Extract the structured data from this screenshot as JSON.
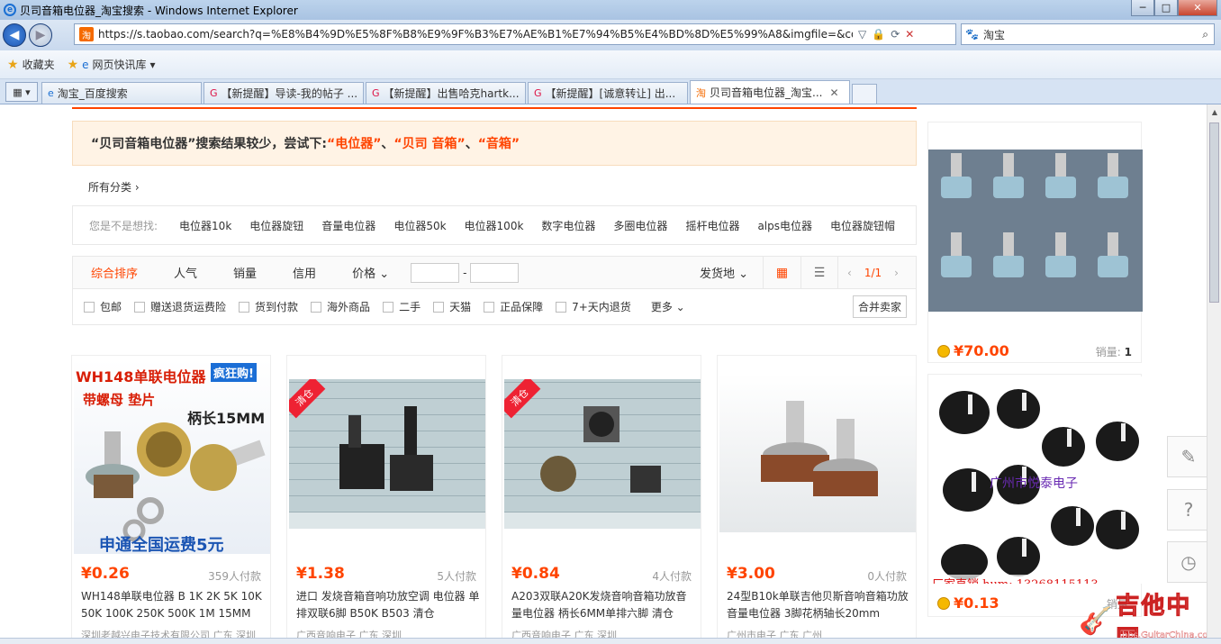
{
  "window": {
    "title": "贝司音箱电位器_淘宝搜索 - Windows Internet Explorer",
    "min": "─",
    "max": "□",
    "close": "✕"
  },
  "address": {
    "url": "https://s.taobao.com/search?q=%E8%B4%9D%E5%8F%B8%E9%9F%B3%E7%AE%B1%E7%94%B5%E4%BD%8D%E5%99%A8&imgfile=&commen"
  },
  "search": {
    "text": "淘宝"
  },
  "favbar": {
    "favorites": "收藏夹",
    "quicklib": "网页快讯库"
  },
  "tabs": [
    {
      "label": "淘宝_百度搜索",
      "icon": "e"
    },
    {
      "label": "【新提醒】导读-我的帖子 ...",
      "icon": "G"
    },
    {
      "label": "【新提醒】出售哈克hartk...",
      "icon": "G"
    },
    {
      "label": "【新提醒】[诚意转让] 出...",
      "icon": "G"
    },
    {
      "label": "贝司音箱电位器_淘宝...",
      "icon": "淘"
    }
  ],
  "notice": {
    "prefix": "“贝司音箱电位器”搜索结果较少，尝试下:",
    "s1": "“电位器”",
    "sep1": "、",
    "s2": "“贝司 音箱”",
    "sep2": "、",
    "s3": "“音箱”"
  },
  "crumb": "所有分类 ›",
  "related": {
    "label": "您是不是想找:",
    "items": [
      "电位器10k",
      "电位器旋钮",
      "音量电位器",
      "电位器50k",
      "电位器100k",
      "数字电位器",
      "多圈电位器",
      "摇杆电位器",
      "alps电位器",
      "电位器旋钮帽"
    ]
  },
  "sort": {
    "items": [
      "综合排序",
      "人气",
      "销量",
      "信用",
      "价格 ⌄"
    ],
    "dash": "-",
    "ship": "发货地 ⌄",
    "prev": "‹",
    "page": "1/1",
    "next": "›"
  },
  "filters": {
    "items": [
      "包邮",
      "赠送退货运费险",
      "货到付款",
      "海外商品",
      "二手",
      "天猫",
      "正品保障",
      "7+天内退货"
    ],
    "more": "更多 ⌄",
    "merge": "合并卖家"
  },
  "products": [
    {
      "price": "¥0.26",
      "paid": "359人付款",
      "title": "WH148单联电位器 B 1K 2K 5K 10K 50K 100K 250K 500K 1M 15MM",
      "shop": "深圳老越兴电子技术有限公司 广东 深圳",
      "banner1": "WH148单联电位器",
      "banner2": "疯狂购!",
      "banner3": "带螺母 垫片",
      "banner4": "柄长15MM",
      "banner5": "申通全国运费5元"
    },
    {
      "price": "¥1.38",
      "paid": "5人付款",
      "title": "进口 发烧音箱音响功放空调 电位器 单排双联6脚 B50K B503 清仓",
      "shop": "广西音响电子 广东 深圳",
      "tag": "清仓"
    },
    {
      "price": "¥0.84",
      "paid": "4人付款",
      "title": "A203双联A20K发烧音响音箱功放音量电位器 柄长6MM单排六脚 清仓",
      "shop": "广西音响电子 广东 深圳",
      "tag": "清仓"
    },
    {
      "price": "¥3.00",
      "paid": "0人付款",
      "title": "24型B10k单联吉他贝斯音响音箱功放音量电位器 3脚花柄轴长20mm",
      "shop": "广州市电子 广东 广州"
    }
  ],
  "side": [
    {
      "price": "¥70.00",
      "sales_label": "销量:",
      "sales": "1"
    },
    {
      "price": "¥0.13",
      "sales_label": "销量:",
      "sales": "",
      "shopname": "广州市悦泰电子",
      "contact": "厂家直销     hum: 13268115113"
    }
  ],
  "watermark": {
    "big": "吉他中国",
    "small": "bbs.GuitarChina.com"
  },
  "colors": {
    "accent": "#ff4400",
    "notice_bg": "#fff3e5"
  }
}
